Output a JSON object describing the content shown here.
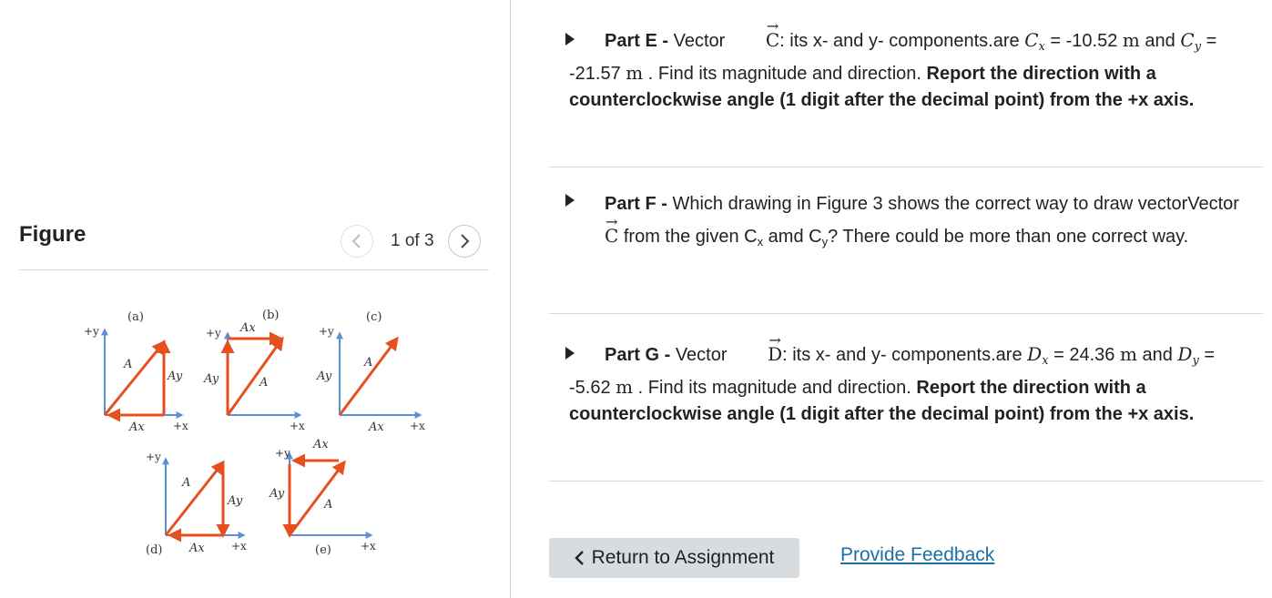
{
  "figure_panel": {
    "title": "Figure",
    "pager": {
      "current_text": "1 of 3"
    },
    "figure_labels": {
      "a": "(a)",
      "b": "(b)",
      "c": "(c)",
      "d": "(d)",
      "e": "(e)",
      "plus_y": "+y",
      "plus_x": "+x",
      "vec_a": "A",
      "ax": "Ax",
      "ay": "Ay"
    },
    "colors": {
      "arrow": "#e5501f",
      "axis": "#5b8fd6",
      "label": "#333333"
    }
  },
  "parts": [
    {
      "label": "Part E -",
      "vector": "C",
      "text_1": ": its x- and y- components.are ",
      "comp_x_sym": "C",
      "comp_x_sub": "x",
      "comp_x_val": " = -10.52 ",
      "unit": "m",
      "and_text": " and",
      "comp_y_sym": "C",
      "comp_y_sub": "y",
      "comp_y_val": " = -21.57 ",
      "tail": " . Find its magnitude and direction. ",
      "bold_text": "Report the direction with a counterclockwise angle (1 digit after the decimal point) from the +x axis."
    },
    {
      "label": "Part F -",
      "text_1": " Which drawing in Figure 3 shows the correct way to draw vectorVector ",
      "vector": "C",
      "text_2": " from the given C",
      "sub_x": "x",
      "text_3": " amd C",
      "sub_y": "y",
      "text_4": "? There could be more than one correct way."
    },
    {
      "label": "Part G -",
      "vector": "D",
      "text_1": ": its x- and y- components.are ",
      "comp_x_sym": "D",
      "comp_x_sub": "x",
      "comp_x_val": " = 24.36 ",
      "unit": "m",
      "and_text": " and",
      "comp_y_sym": "D",
      "comp_y_sub": "y",
      "comp_y_val": " = -5.62 ",
      "tail": " . Find its magnitude and direction. ",
      "bold_text": "Report the direction with a counterclockwise angle (1 digit after the decimal point) from the +x axis."
    }
  ],
  "footer": {
    "return_label": "Return to Assignment",
    "feedback_label": "Provide Feedback"
  }
}
